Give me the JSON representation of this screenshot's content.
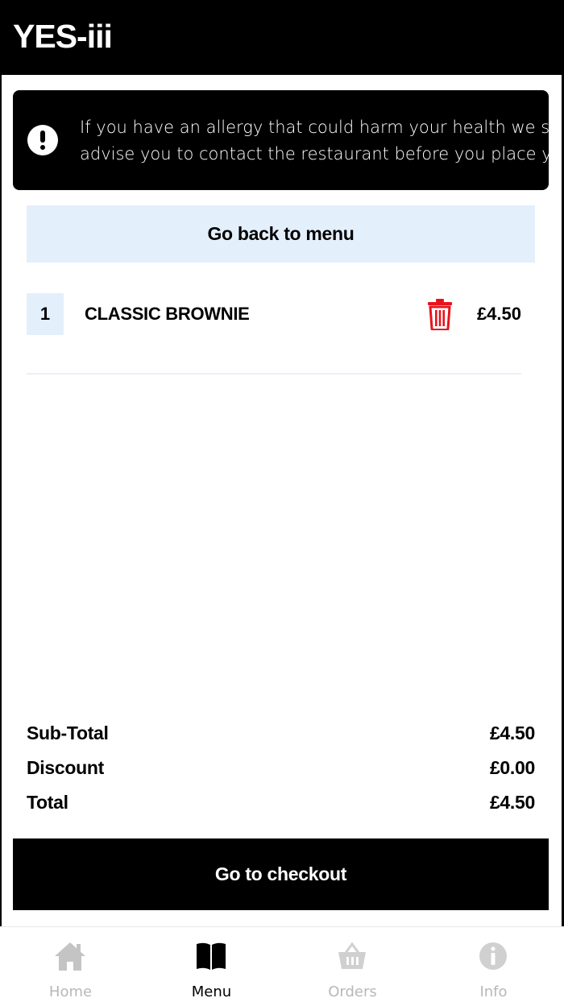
{
  "app": {
    "title": "YES-iii"
  },
  "notice": {
    "line1": "If you have an allergy that could harm your health we strongly",
    "line2": "advise you to contact the restaurant before you place your order",
    "icon": "exclamation-circle-icon"
  },
  "back_button": {
    "label": "Go back to menu"
  },
  "basket": {
    "items": [
      {
        "qty": "1",
        "name": "CLASSIC BROWNIE",
        "price": "£4.50",
        "delete_icon": "trash-icon"
      }
    ]
  },
  "totals": {
    "subtotal_label": "Sub-Total",
    "subtotal_value": "£4.50",
    "discount_label": "Discount",
    "discount_value": "£0.00",
    "total_label": "Total",
    "total_value": "£4.50"
  },
  "checkout_button": {
    "label": "Go to checkout"
  },
  "nav": {
    "items": [
      {
        "label": "Home",
        "icon": "home-icon",
        "active": false
      },
      {
        "label": "Menu",
        "icon": "book-icon",
        "active": true
      },
      {
        "label": "Orders",
        "icon": "basket-icon",
        "active": false
      },
      {
        "label": "Info",
        "icon": "info-icon",
        "active": false
      }
    ]
  },
  "colors": {
    "accent_light": "#e4effc",
    "delete": "#e8141c",
    "inactive": "#b8b8b8"
  }
}
